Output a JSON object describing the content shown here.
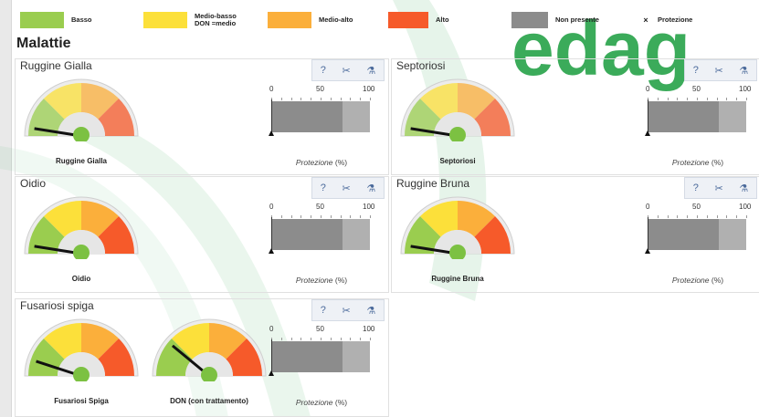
{
  "legend": [
    {
      "label": "Basso",
      "color": "#9acd4f"
    },
    {
      "label": "Medio-basso\nDON =medio",
      "color": "#fce03a"
    },
    {
      "label": "Medio-alto",
      "color": "#fbaf3b"
    },
    {
      "label": "Alto",
      "color": "#f65a2a"
    },
    {
      "label": "Non presente",
      "color": "#8c8c8c"
    },
    {
      "label": "Protezione",
      "symbol": "×"
    }
  ],
  "section_title": "Malattie",
  "watermark": "edag",
  "toolbar_icons": [
    "help-icon",
    "tools-icon",
    "flask-icon"
  ],
  "toolbar_glyphs": [
    "?",
    "✂",
    "⚗"
  ],
  "protection_axis": {
    "ticks": [
      "0",
      "50",
      "100"
    ],
    "label": "Protezione",
    "unit": "(%)"
  },
  "panels": [
    {
      "title": "Ruggine Gialla",
      "gauges": [
        {
          "label": "Ruggine Gialla",
          "level": 0.05,
          "faded": true
        }
      ],
      "protection": {
        "fill": 0.72
      }
    },
    {
      "title": "Septoriosi",
      "gauges": [
        {
          "label": "Septoriosi",
          "level": 0.05,
          "faded": true
        }
      ],
      "protection": {
        "fill": 0.72
      }
    },
    {
      "title": "Oidio",
      "gauges": [
        {
          "label": "Oidio",
          "level": 0.05,
          "faded": false
        }
      ],
      "protection": {
        "fill": 0.72
      }
    },
    {
      "title": "Ruggine Bruna",
      "gauges": [
        {
          "label": "Ruggine Bruna",
          "level": 0.05,
          "faded": false
        }
      ],
      "protection": {
        "fill": 0.72
      }
    },
    {
      "title": "Fusariosi spiga",
      "gauges": [
        {
          "label": "Fusariosi Spiga",
          "level": 0.1,
          "faded": false
        },
        {
          "label": "DON (con trattamento)",
          "level": 0.22,
          "faded": false
        }
      ],
      "protection": {
        "fill": 0.72
      }
    }
  ]
}
